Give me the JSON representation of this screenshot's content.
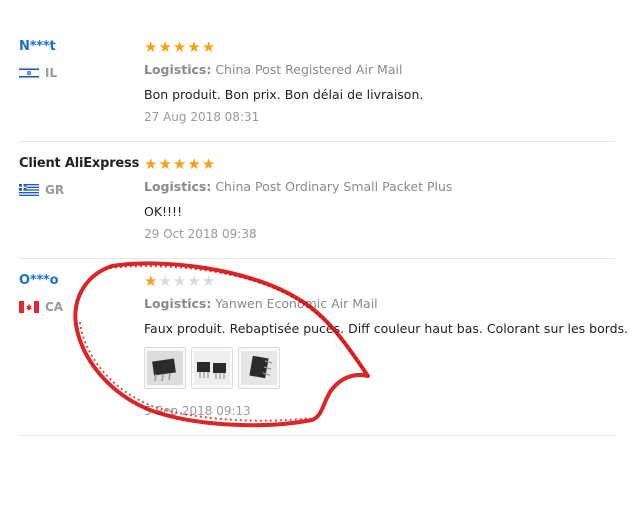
{
  "reviews": [
    {
      "user": "N***t",
      "country": "IL",
      "flag": "israel-flag",
      "rating": 5,
      "logistics_label": "Logistics:",
      "logistics": "China Post Registered Air Mail",
      "text": "Bon produit. Bon prix. Bon délai de livraison.",
      "date": "27 Aug 2018 08:31"
    },
    {
      "user": "Client AliExpress",
      "country": "GR",
      "flag": "greece-flag",
      "rating": 5,
      "logistics_label": "Logistics:",
      "logistics": "China Post Ordinary Small Packet Plus",
      "text": "OK!!!!",
      "date": "29 Oct 2018 09:38"
    },
    {
      "user": "O***o",
      "country": "CA",
      "flag": "canada-flag",
      "rating": 1,
      "logistics_label": "Logistics:",
      "logistics": "Yanwen Economic Air Mail",
      "text": "Faux produit. Rebaptisée puces. Diff couleur haut bas. Colorant sur les bords.",
      "date": "5 Sep 2018 09:13",
      "photos": [
        "chip-photo-1",
        "chip-photo-2",
        "chip-photo-3"
      ]
    }
  ],
  "colors": {
    "star": "#f8a012",
    "star_off": "#d9d9d9",
    "user_link": "#1a6fc9",
    "scribble": "#d40000"
  }
}
